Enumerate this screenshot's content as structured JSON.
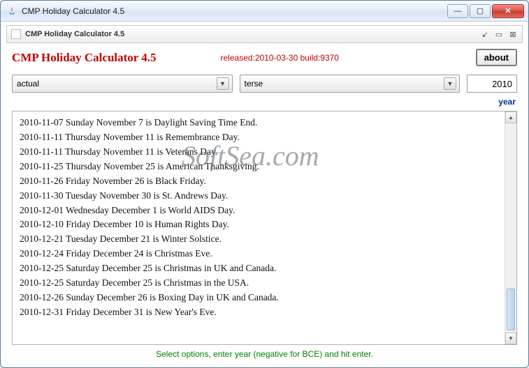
{
  "window": {
    "title": "CMP Holiday Calculator 4.5",
    "internal_title": "CMP Holiday Calculator 4.5"
  },
  "header": {
    "app_title": "CMP Holiday Calculator 4.5",
    "release": "released:2010-03-30 build:9370",
    "about_label": "about"
  },
  "controls": {
    "mode": {
      "selected": "actual"
    },
    "format": {
      "selected": "terse"
    },
    "year_value": "2010",
    "year_label": "year"
  },
  "results": [
    "2010-11-07 Sunday November 7 is Daylight Saving Time End.",
    "2010-11-11 Thursday November 11 is Remembrance Day.",
    "2010-11-11 Thursday November 11 is Veterans Day.",
    "2010-11-25 Thursday November 25 is American Thanksgiving.",
    "2010-11-26 Friday November 26 is Black Friday.",
    "2010-11-30 Tuesday November 30 is St. Andrews Day.",
    "2010-12-01 Wednesday December 1 is World AIDS Day.",
    "2010-12-10 Friday December 10 is Human Rights Day.",
    "2010-12-21 Tuesday December 21 is Winter Solstice.",
    "2010-12-24 Friday December 24 is Christmas Eve.",
    "2010-12-25 Saturday December 25 is Christmas in UK and Canada.",
    "2010-12-25 Saturday December 25 is Christmas in the USA.",
    "2010-12-26 Sunday December 26 is Boxing Day in UK and Canada.",
    "2010-12-31 Friday December 31 is New Year's Eve."
  ],
  "hint": "Select options, enter year (negative for BCE) and hit enter.",
  "watermark": "SoftSea.com"
}
